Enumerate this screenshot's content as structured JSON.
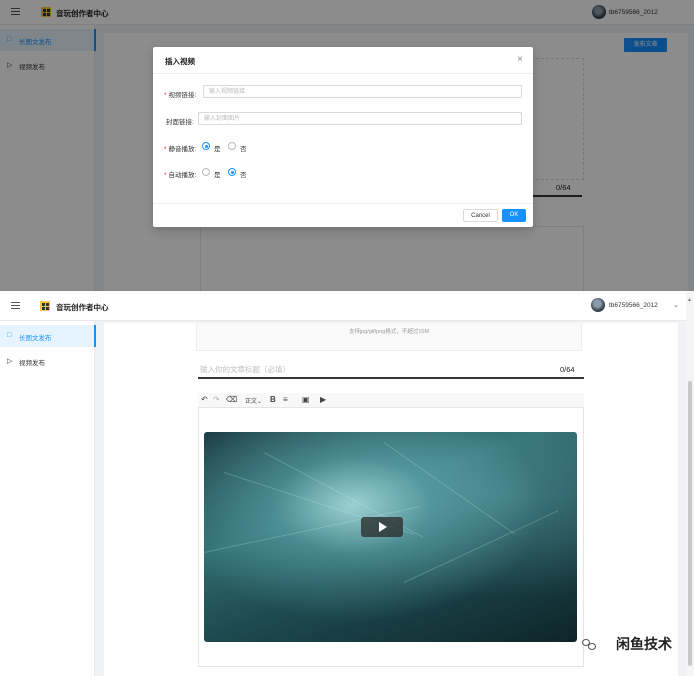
{
  "header": {
    "app_title": "音玩创作者中心",
    "username": "tb6759566_2012"
  },
  "sidebar": {
    "items": [
      {
        "label": "长图文发布",
        "icon": "document-icon"
      },
      {
        "label": "视频发布",
        "icon": "video-camera-icon"
      }
    ]
  },
  "top": {
    "publish_label": "发布文章",
    "counter": "0/64",
    "modal": {
      "title": "插入视频",
      "video_link_label": "视频链接:",
      "video_link_placeholder": "输入视频链接",
      "cover_link_label": "封面链接:",
      "cover_link_placeholder": "输入封面图片",
      "mute_label": "静音播放:",
      "autoplay_label": "自动播放:",
      "yes": "是",
      "no": "否",
      "mute_value": "是",
      "autoplay_value": "否",
      "cancel_label": "Cancel",
      "ok_label": "OK"
    }
  },
  "bottom": {
    "upload_hint": "支持jpg/gif/png格式，不超过10M",
    "title_placeholder": "输入你的文章标题（必填）",
    "counter": "0/64",
    "toolbar": {
      "undo_icon": "undo-icon",
      "redo_icon": "redo-icon",
      "eraser_icon": "eraser-icon",
      "paragraph_label": "正文",
      "bold_label": "B",
      "align_icon": "align-icon",
      "image_icon": "image-icon",
      "video_icon": "video-icon"
    }
  },
  "watermark": "闲鱼技术"
}
